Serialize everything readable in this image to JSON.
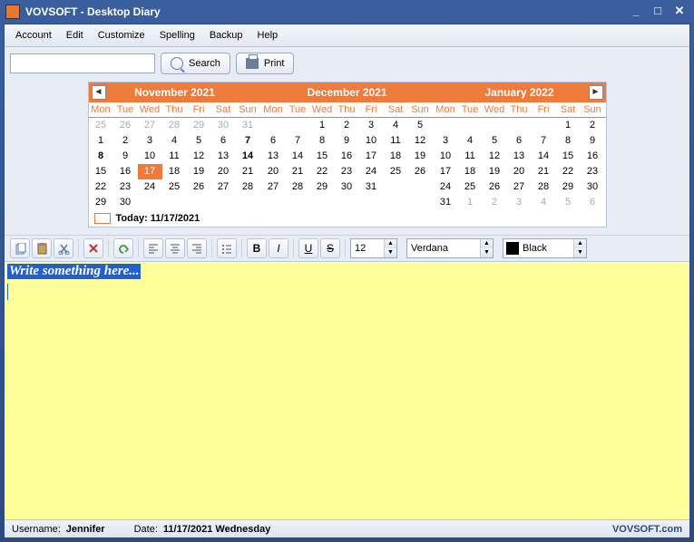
{
  "window": {
    "title": "VOVSOFT - Desktop Diary"
  },
  "menu": {
    "items": [
      "Account",
      "Edit",
      "Customize",
      "Spelling",
      "Backup",
      "Help"
    ]
  },
  "toolbar": {
    "search_placeholder": "",
    "search_label": "Search",
    "print_label": "Print"
  },
  "calendar": {
    "dow": [
      "Mon",
      "Tue",
      "Wed",
      "Thu",
      "Fri",
      "Sat",
      "Sun"
    ],
    "today_label": "Today: 11/17/2021",
    "months": [
      {
        "title": "November 2021",
        "nav": "prev",
        "cells": [
          {
            "d": 25,
            "g": true
          },
          {
            "d": 26,
            "g": true
          },
          {
            "d": 27,
            "g": true
          },
          {
            "d": 28,
            "g": true
          },
          {
            "d": 29,
            "g": true
          },
          {
            "d": 30,
            "g": true
          },
          {
            "d": 31,
            "g": true
          },
          {
            "d": 1
          },
          {
            "d": 2
          },
          {
            "d": 3
          },
          {
            "d": 4
          },
          {
            "d": 5
          },
          {
            "d": 6
          },
          {
            "d": 7,
            "b": true
          },
          {
            "d": 8,
            "b": true
          },
          {
            "d": 9
          },
          {
            "d": 10
          },
          {
            "d": 11
          },
          {
            "d": 12
          },
          {
            "d": 13
          },
          {
            "d": 14,
            "b": true
          },
          {
            "d": 15
          },
          {
            "d": 16
          },
          {
            "d": 17,
            "t": true
          },
          {
            "d": 18
          },
          {
            "d": 19
          },
          {
            "d": 20
          },
          {
            "d": 21
          },
          {
            "d": 22
          },
          {
            "d": 23
          },
          {
            "d": 24
          },
          {
            "d": 25
          },
          {
            "d": 26
          },
          {
            "d": 27
          },
          {
            "d": 28
          },
          {
            "d": 29
          },
          {
            "d": 30
          },
          {
            "d": "",
            "e": true
          },
          {
            "d": "",
            "e": true
          },
          {
            "d": "",
            "e": true
          },
          {
            "d": "",
            "e": true
          },
          {
            "d": "",
            "e": true
          }
        ]
      },
      {
        "title": "December 2021",
        "cells": [
          {
            "d": "",
            "e": true
          },
          {
            "d": "",
            "e": true
          },
          {
            "d": 1
          },
          {
            "d": 2
          },
          {
            "d": 3
          },
          {
            "d": 4
          },
          {
            "d": 5
          },
          {
            "d": 6
          },
          {
            "d": 7
          },
          {
            "d": 8
          },
          {
            "d": 9
          },
          {
            "d": 10
          },
          {
            "d": 11
          },
          {
            "d": 12
          },
          {
            "d": 13
          },
          {
            "d": 14
          },
          {
            "d": 15
          },
          {
            "d": 16
          },
          {
            "d": 17
          },
          {
            "d": 18
          },
          {
            "d": 19
          },
          {
            "d": 20
          },
          {
            "d": 21
          },
          {
            "d": 22
          },
          {
            "d": 23
          },
          {
            "d": 24
          },
          {
            "d": 25
          },
          {
            "d": 26
          },
          {
            "d": 27
          },
          {
            "d": 28
          },
          {
            "d": 29
          },
          {
            "d": 30
          },
          {
            "d": 31
          },
          {
            "d": "",
            "e": true
          },
          {
            "d": "",
            "e": true
          },
          {
            "d": "",
            "e": true
          },
          {
            "d": "",
            "e": true
          },
          {
            "d": "",
            "e": true
          },
          {
            "d": "",
            "e": true
          },
          {
            "d": "",
            "e": true
          },
          {
            "d": "",
            "e": true
          },
          {
            "d": "",
            "e": true
          }
        ]
      },
      {
        "title": "January 2022",
        "nav": "next",
        "cells": [
          {
            "d": "",
            "e": true
          },
          {
            "d": "",
            "e": true
          },
          {
            "d": "",
            "e": true
          },
          {
            "d": "",
            "e": true
          },
          {
            "d": "",
            "e": true
          },
          {
            "d": 1
          },
          {
            "d": 2
          },
          {
            "d": 3
          },
          {
            "d": 4
          },
          {
            "d": 5
          },
          {
            "d": 6
          },
          {
            "d": 7
          },
          {
            "d": 8
          },
          {
            "d": 9
          },
          {
            "d": 10
          },
          {
            "d": 11
          },
          {
            "d": 12
          },
          {
            "d": 13
          },
          {
            "d": 14
          },
          {
            "d": 15
          },
          {
            "d": 16
          },
          {
            "d": 17
          },
          {
            "d": 18
          },
          {
            "d": 19
          },
          {
            "d": 20
          },
          {
            "d": 21
          },
          {
            "d": 22
          },
          {
            "d": 23
          },
          {
            "d": 24
          },
          {
            "d": 25
          },
          {
            "d": 26
          },
          {
            "d": 27
          },
          {
            "d": 28
          },
          {
            "d": 29
          },
          {
            "d": 30
          },
          {
            "d": 31
          },
          {
            "d": 1,
            "g": true
          },
          {
            "d": 2,
            "g": true
          },
          {
            "d": 3,
            "g": true
          },
          {
            "d": 4,
            "g": true
          },
          {
            "d": 5,
            "g": true
          },
          {
            "d": 6,
            "g": true
          }
        ]
      }
    ]
  },
  "format": {
    "font_size": "12",
    "font_name": "Verdana",
    "font_color": "Black"
  },
  "editor": {
    "placeholder": "Write something here..."
  },
  "status": {
    "username_label": "Username:",
    "username": "Jennifer",
    "date_label": "Date:",
    "date": "11/17/2021 Wednesday",
    "brand": "VOVSOFT.com"
  }
}
